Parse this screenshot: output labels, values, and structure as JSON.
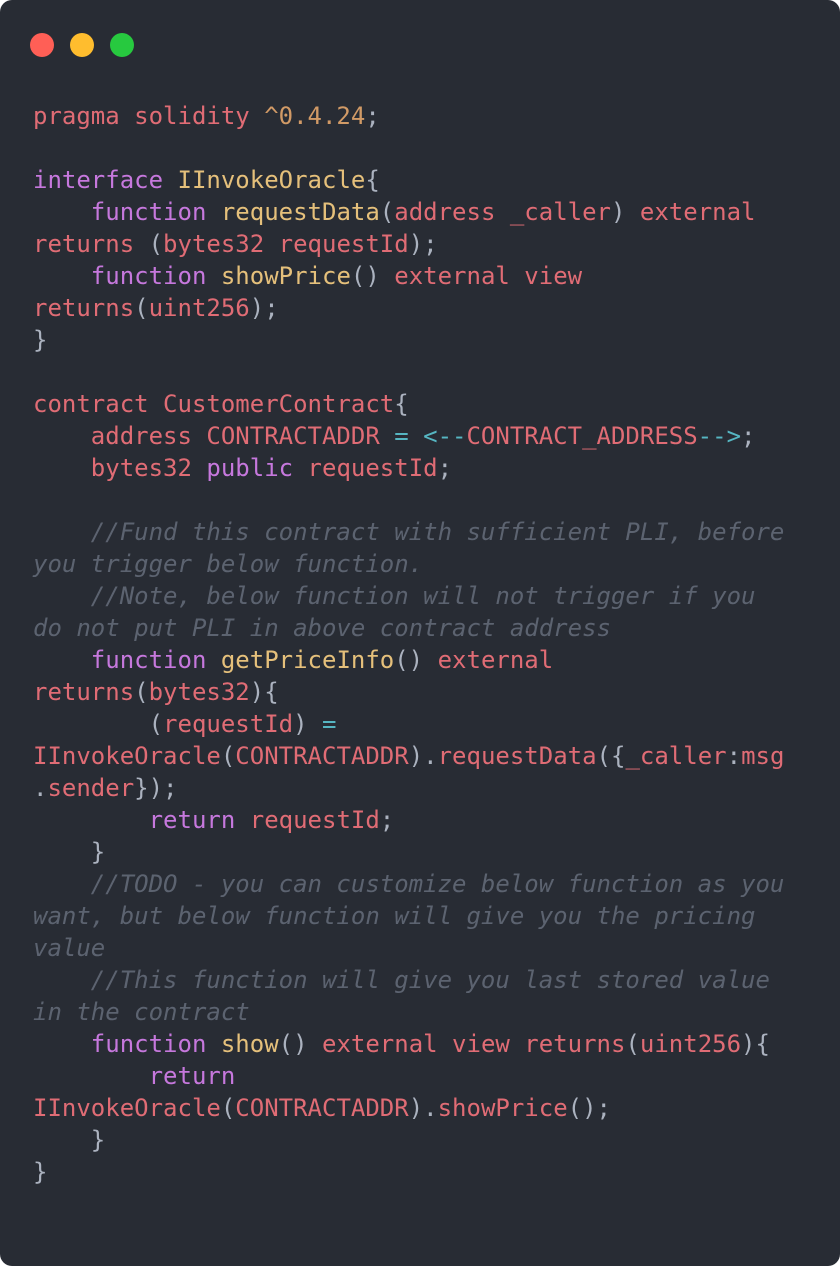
{
  "window": {
    "background": "#282c34",
    "controls": [
      {
        "name": "close",
        "color": "#ff5f56"
      },
      {
        "name": "minimize",
        "color": "#ffbd2e"
      },
      {
        "name": "zoom",
        "color": "#27c93f"
      }
    ]
  },
  "theme": {
    "keyword": "#c678dd",
    "type": "#e06c75",
    "function": "#e5c07b",
    "number": "#d19a66",
    "operator": "#56b6c2",
    "comment": "#5c6370",
    "punct": "#abb2bf"
  },
  "code": {
    "language": "solidity",
    "lines": [
      [
        {
          "t": "pragma solidity ",
          "k": "type"
        },
        {
          "t": "^0.4.24",
          "k": "number"
        },
        {
          "t": ";",
          "k": "punct"
        }
      ],
      [],
      [
        {
          "t": "interface ",
          "k": "keyword"
        },
        {
          "t": "IInvokeOracle",
          "k": "function"
        },
        {
          "t": "{",
          "k": "punct"
        }
      ],
      [
        {
          "t": "    ",
          "k": "punct"
        },
        {
          "t": "function ",
          "k": "keyword"
        },
        {
          "t": "requestData",
          "k": "function"
        },
        {
          "t": "(",
          "k": "punct"
        },
        {
          "t": "address _caller",
          "k": "type"
        },
        {
          "t": ") ",
          "k": "punct"
        },
        {
          "t": "external",
          "k": "type"
        }
      ],
      [
        {
          "t": "returns ",
          "k": "type"
        },
        {
          "t": "(",
          "k": "punct"
        },
        {
          "t": "bytes32 requestId",
          "k": "type"
        },
        {
          "t": ");",
          "k": "punct"
        }
      ],
      [
        {
          "t": "    ",
          "k": "punct"
        },
        {
          "t": "function ",
          "k": "keyword"
        },
        {
          "t": "showPrice",
          "k": "function"
        },
        {
          "t": "() ",
          "k": "punct"
        },
        {
          "t": "external view",
          "k": "type"
        }
      ],
      [
        {
          "t": "returns",
          "k": "type"
        },
        {
          "t": "(",
          "k": "punct"
        },
        {
          "t": "uint256",
          "k": "type"
        },
        {
          "t": ");",
          "k": "punct"
        }
      ],
      [
        {
          "t": "}",
          "k": "punct"
        }
      ],
      [],
      [
        {
          "t": "contract ",
          "k": "type"
        },
        {
          "t": "CustomerContract",
          "k": "type"
        },
        {
          "t": "{",
          "k": "punct"
        }
      ],
      [
        {
          "t": "    ",
          "k": "punct"
        },
        {
          "t": "address CONTRACTADDR ",
          "k": "type"
        },
        {
          "t": "= <--",
          "k": "operator"
        },
        {
          "t": "CONTRACT_ADDRESS",
          "k": "type"
        },
        {
          "t": "-->",
          "k": "operator"
        },
        {
          "t": ";",
          "k": "punct"
        }
      ],
      [
        {
          "t": "    ",
          "k": "punct"
        },
        {
          "t": "bytes32 ",
          "k": "type"
        },
        {
          "t": "public ",
          "k": "keyword"
        },
        {
          "t": "requestId",
          "k": "type"
        },
        {
          "t": ";",
          "k": "punct"
        }
      ],
      [],
      [
        {
          "t": "    //Fund this contract with sufficient PLI, before",
          "k": "comment"
        }
      ],
      [
        {
          "t": "you trigger below function.",
          "k": "comment"
        }
      ],
      [
        {
          "t": "    //Note, below function will not trigger if you",
          "k": "comment"
        }
      ],
      [
        {
          "t": "do not put PLI in above contract address",
          "k": "comment"
        }
      ],
      [
        {
          "t": "    ",
          "k": "punct"
        },
        {
          "t": "function ",
          "k": "keyword"
        },
        {
          "t": "getPriceInfo",
          "k": "function"
        },
        {
          "t": "() ",
          "k": "punct"
        },
        {
          "t": "external",
          "k": "type"
        }
      ],
      [
        {
          "t": "returns",
          "k": "type"
        },
        {
          "t": "(",
          "k": "punct"
        },
        {
          "t": "bytes32",
          "k": "type"
        },
        {
          "t": "){",
          "k": "punct"
        }
      ],
      [
        {
          "t": "        (",
          "k": "punct"
        },
        {
          "t": "requestId",
          "k": "type"
        },
        {
          "t": ") ",
          "k": "punct"
        },
        {
          "t": "=",
          "k": "operator"
        }
      ],
      [
        {
          "t": "IInvokeOracle",
          "k": "type"
        },
        {
          "t": "(",
          "k": "punct"
        },
        {
          "t": "CONTRACTADDR",
          "k": "type"
        },
        {
          "t": ").",
          "k": "punct"
        },
        {
          "t": "requestData",
          "k": "type"
        },
        {
          "t": "({",
          "k": "punct"
        },
        {
          "t": "_caller",
          "k": "type"
        },
        {
          "t": ":",
          "k": "punct"
        },
        {
          "t": "msg",
          "k": "type"
        }
      ],
      [
        {
          "t": ".",
          "k": "punct"
        },
        {
          "t": "sender",
          "k": "type"
        },
        {
          "t": "});",
          "k": "punct"
        }
      ],
      [
        {
          "t": "        ",
          "k": "punct"
        },
        {
          "t": "return ",
          "k": "keyword"
        },
        {
          "t": "requestId",
          "k": "type"
        },
        {
          "t": ";",
          "k": "punct"
        }
      ],
      [
        {
          "t": "    }",
          "k": "punct"
        }
      ],
      [
        {
          "t": "    //TODO - you can customize below function as you",
          "k": "comment"
        }
      ],
      [
        {
          "t": "want, but below function will give you the pricing",
          "k": "comment"
        }
      ],
      [
        {
          "t": "value",
          "k": "comment"
        }
      ],
      [
        {
          "t": "    //This function will give you last stored value",
          "k": "comment"
        }
      ],
      [
        {
          "t": "in the contract",
          "k": "comment"
        }
      ],
      [
        {
          "t": "    ",
          "k": "punct"
        },
        {
          "t": "function ",
          "k": "keyword"
        },
        {
          "t": "show",
          "k": "function"
        },
        {
          "t": "() ",
          "k": "punct"
        },
        {
          "t": "external view returns",
          "k": "type"
        },
        {
          "t": "(",
          "k": "punct"
        },
        {
          "t": "uint256",
          "k": "type"
        },
        {
          "t": "){",
          "k": "punct"
        }
      ],
      [
        {
          "t": "        ",
          "k": "punct"
        },
        {
          "t": "return",
          "k": "keyword"
        }
      ],
      [
        {
          "t": "IInvokeOracle",
          "k": "type"
        },
        {
          "t": "(",
          "k": "punct"
        },
        {
          "t": "CONTRACTADDR",
          "k": "type"
        },
        {
          "t": ").",
          "k": "punct"
        },
        {
          "t": "showPrice",
          "k": "type"
        },
        {
          "t": "();",
          "k": "punct"
        }
      ],
      [
        {
          "t": "    }",
          "k": "punct"
        }
      ],
      [
        {
          "t": "}",
          "k": "punct"
        }
      ]
    ]
  }
}
